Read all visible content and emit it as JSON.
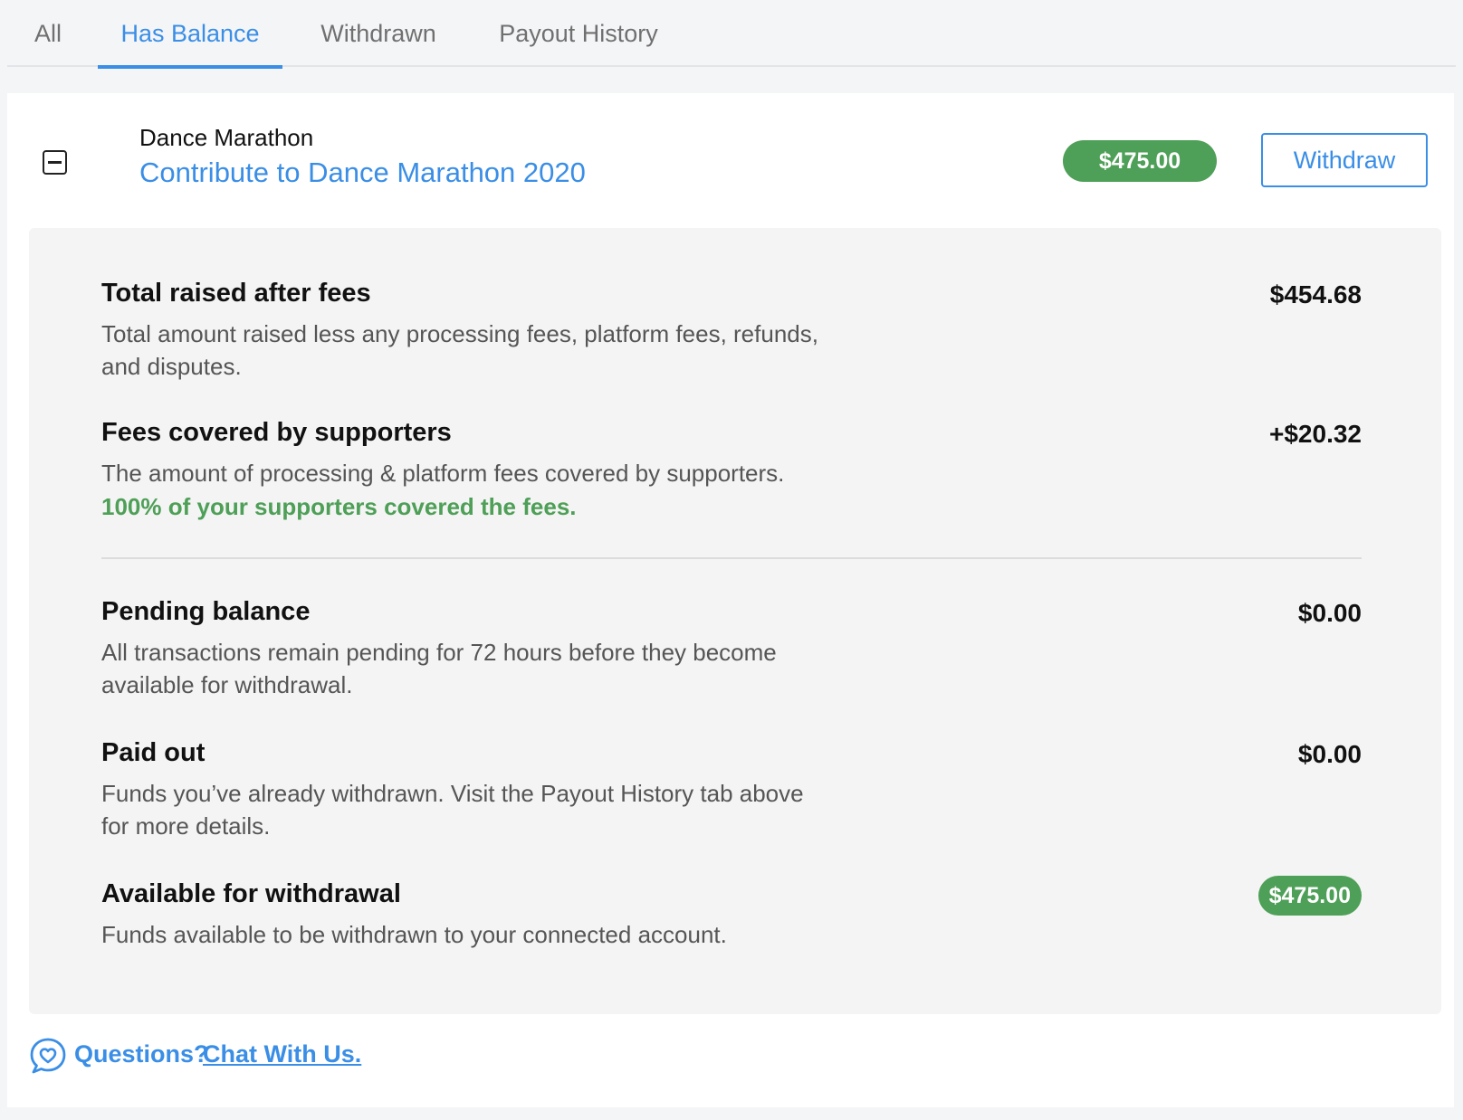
{
  "tabs": [
    {
      "label": "All",
      "active": false
    },
    {
      "label": "Has Balance",
      "active": true
    },
    {
      "label": "Withdrawn",
      "active": false
    },
    {
      "label": "Payout History",
      "active": false
    }
  ],
  "campaign": {
    "org_name": "Dance Marathon",
    "title": "Contribute to Dance Marathon 2020",
    "balance": "$475.00",
    "withdraw_label": "Withdraw"
  },
  "details": {
    "total_raised": {
      "title": "Total raised after fees",
      "description": "Total amount raised less any processing fees, platform fees, refunds, and disputes.",
      "value": "$454.68"
    },
    "fees_covered": {
      "title": "Fees covered by supporters",
      "description": "The amount of processing & platform fees covered by supporters.",
      "note": "100% of your supporters covered the fees.",
      "value": "+$20.32"
    },
    "pending": {
      "title": "Pending balance",
      "description": "All transactions remain pending for 72 hours before they become available for withdrawal.",
      "value": "$0.00"
    },
    "paid_out": {
      "title": "Paid out",
      "description": "Funds you’ve already withdrawn. Visit the Payout History tab above for more details.",
      "value": "$0.00"
    },
    "available": {
      "title": "Available for withdrawal",
      "description": "Funds available to be withdrawn to your connected account.",
      "value": "$475.00"
    }
  },
  "footer": {
    "question": "Questions?",
    "chat_link": "Chat With Us."
  },
  "colors": {
    "accent": "#3a8ee6",
    "success": "#4e9f57"
  }
}
